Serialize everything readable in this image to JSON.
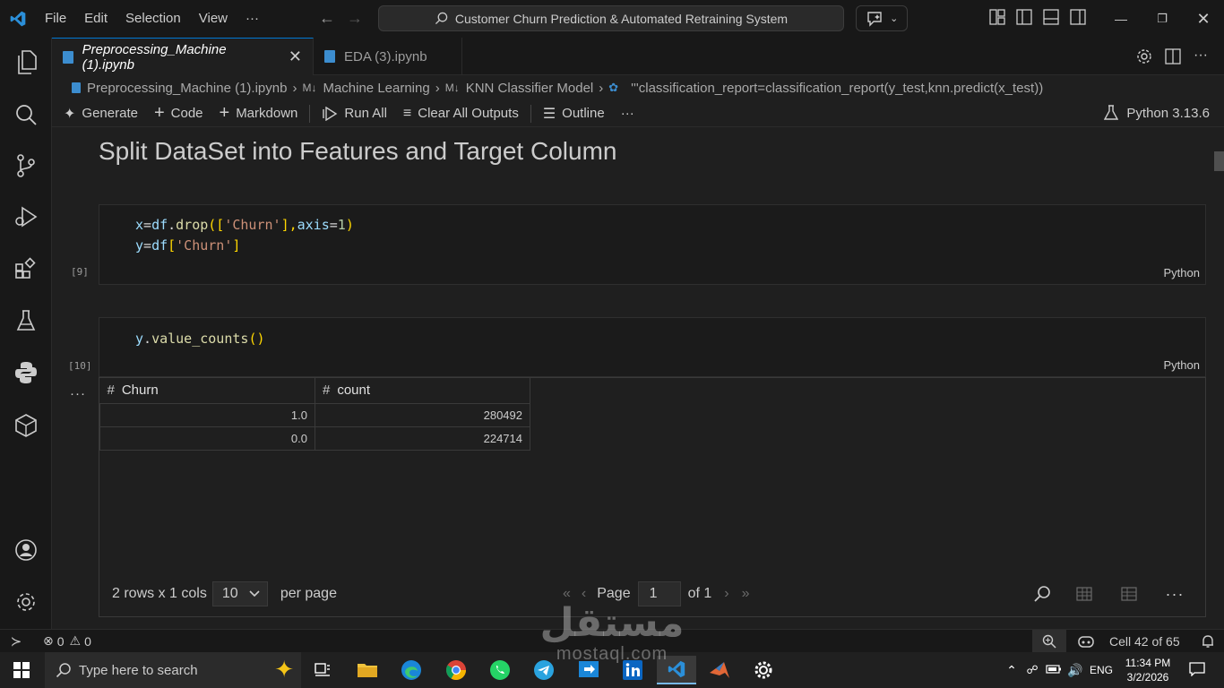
{
  "menu": [
    "File",
    "Edit",
    "Selection",
    "View",
    "···"
  ],
  "command_center": "Customer Churn Prediction & Automated Retraining System",
  "tabs": [
    {
      "label": "Preprocessing_Machine (1).ipynb",
      "active": true
    },
    {
      "label": "EDA (3).ipynb",
      "active": false
    }
  ],
  "breadcrumb": [
    "Preprocessing_Machine (1).ipynb",
    "Machine Learning",
    "KNN Classifier Model",
    "'''classification_report=classification_report(y_test,knn.predict(x_test))"
  ],
  "toolbar": {
    "generate": "Generate",
    "code": "Code",
    "markdown": "Markdown",
    "run_all": "Run All",
    "clear_all": "Clear All Outputs",
    "outline": "Outline",
    "more": "···",
    "kernel": "Python 3.13.6"
  },
  "notebook": {
    "heading": "Split DataSet into Features and Target Column",
    "cell1": {
      "exec": "[9]",
      "line1": {
        "a": "x",
        "b": "=",
        "c": "df",
        "d": ".",
        "e": "drop",
        "f": "([",
        "g": "'Churn'",
        "h": "],",
        "i": "axis",
        "j": "=",
        "k": "1",
        "l": ")"
      },
      "line2": {
        "a": "y",
        "b": "=",
        "c": "df",
        "d": "[",
        "e": "'Churn'",
        "f": "]"
      },
      "lang": "Python"
    },
    "cell2": {
      "exec": "[10]",
      "line1": {
        "a": "y",
        "b": ".",
        "c": "value_counts",
        "d": "()"
      },
      "lang": "Python"
    },
    "output": {
      "dots": "···",
      "columns": [
        "Churn",
        "count"
      ],
      "rows": [
        [
          "1.0",
          "280492"
        ],
        [
          "0.0",
          "224714"
        ]
      ],
      "pager": {
        "summary": "2 rows x 1 cols",
        "page_size": "10",
        "per_page": "per page",
        "page_label": "Page",
        "page_value": "1",
        "of_label": "of 1"
      }
    }
  },
  "statusbar": {
    "errors": "0",
    "warnings": "0",
    "cell_position": "Cell 42 of 65"
  },
  "taskbar": {
    "search_placeholder": "Type here to search",
    "lang": "ENG",
    "time": "11:34 PM",
    "date": "3/2/2026"
  },
  "watermark": {
    "arabic": "مستقل",
    "latin": "mostaql.com"
  },
  "colors": {
    "accent": "#0078d4",
    "editor_bg": "#1f1f1f",
    "chrome_bg": "#181818"
  }
}
